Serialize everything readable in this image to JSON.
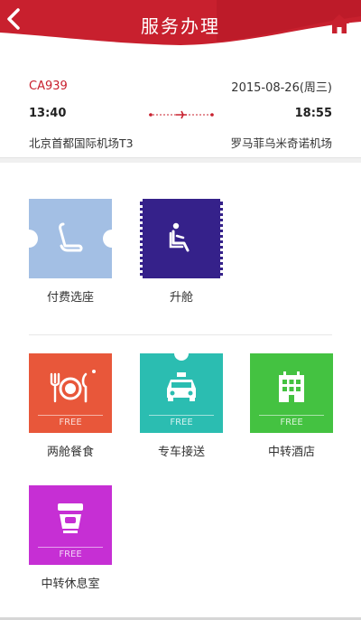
{
  "header": {
    "title": "服务办理"
  },
  "flight": {
    "number": "CA939",
    "date": "2015-08-26(周三)",
    "depart_time": "13:40",
    "arrive_time": "18:55",
    "depart_airport": "北京首都国际机场T3",
    "arrive_airport": "罗马菲乌米奇诺机场"
  },
  "services": [
    {
      "label": "付费选座",
      "icon": "seat-icon",
      "color": "#a3bfe4"
    },
    {
      "label": "升舱",
      "icon": "upgrade-seat-icon",
      "color": "#35218a"
    },
    {
      "label": "两舱餐食",
      "icon": "dining-icon",
      "color": "#e8573a",
      "badge": "FREE"
    },
    {
      "label": "专车接送",
      "icon": "taxi-icon",
      "color": "#2bbdb1",
      "badge": "FREE"
    },
    {
      "label": "中转酒店",
      "icon": "hotel-icon",
      "color": "#44c241",
      "badge": "FREE"
    },
    {
      "label": "中转休息室",
      "icon": "lounge-icon",
      "color": "#c62fd4",
      "badge": "FREE"
    }
  ],
  "colors": {
    "brand_red": "#c8202e"
  }
}
